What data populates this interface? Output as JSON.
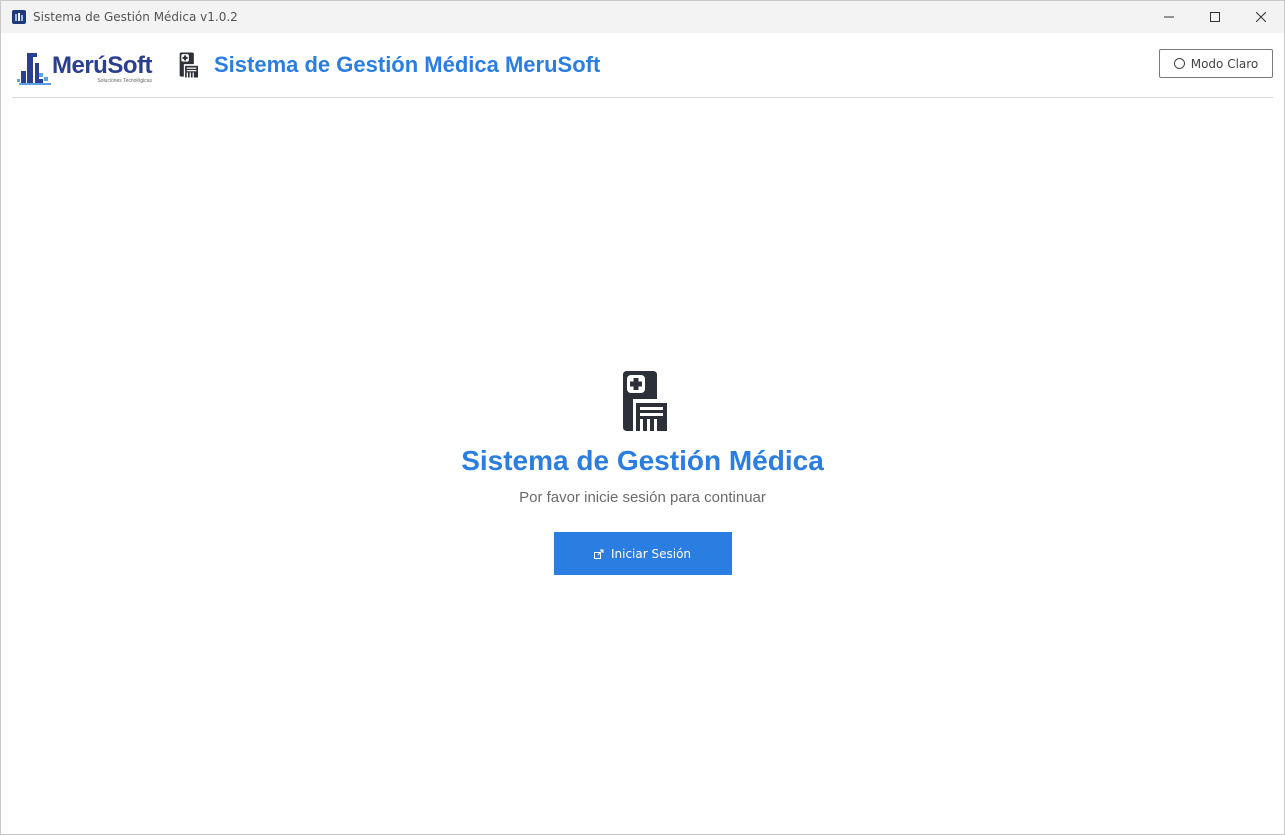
{
  "window": {
    "title": "Sistema de Gestión Médica v1.0.2"
  },
  "header": {
    "logo_name": "MerúSoft",
    "logo_tagline": "Soluciones Tecnológicas",
    "title": "Sistema de Gestión Médica MeruSoft",
    "mode_button_label": "Modo Claro"
  },
  "main": {
    "title": "Sistema de Gestión Médica",
    "subtitle": "Por favor inicie sesión para continuar",
    "login_button_label": "Iniciar Sesión"
  },
  "icons": {
    "app": "app-logo-icon",
    "header": "medical-file-icon",
    "main": "medical-file-icon",
    "login": "login-icon",
    "mode": "circle-icon"
  },
  "colors": {
    "accent": "#2a7de1",
    "brand_dark": "#2a3f8f",
    "icon_dark": "#2d3038"
  }
}
